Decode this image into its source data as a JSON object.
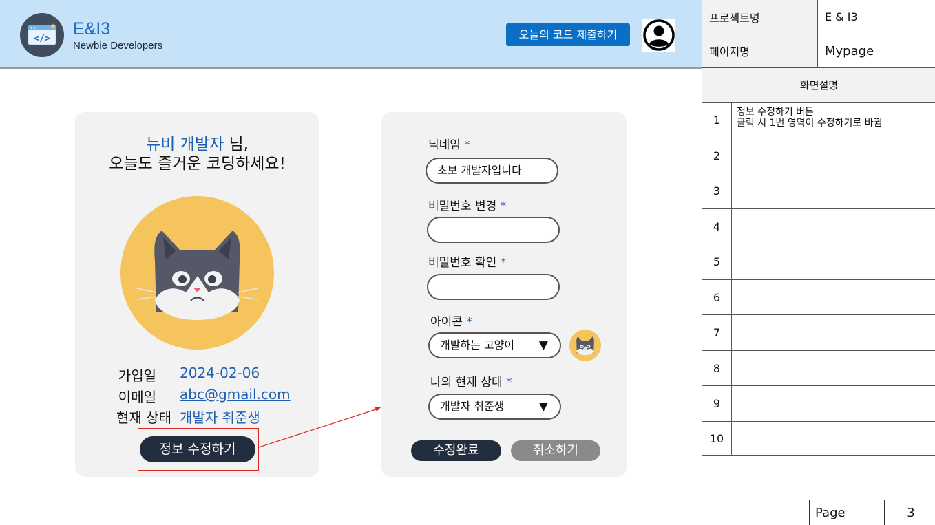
{
  "header": {
    "app_name": "E&I3",
    "app_subtitle": "Newbie Developers",
    "submit_code_label": "오늘의 코드 제출하기",
    "logo_icon": "code-window-icon",
    "avatar_icon": "user-avatar-icon",
    "colors": {
      "background": "#c5e2f8",
      "accent": "#0b6fc7"
    }
  },
  "profile_card": {
    "nickname": "뉴비 개발자",
    "greeting_suffix": " 님,",
    "greeting_line2": "오늘도 즐거운 코딩하세요!",
    "avatar_icon": "cat-icon",
    "info": [
      {
        "label": "가입일",
        "value": "2024-02-06"
      },
      {
        "label": "이메일",
        "value": "abc@gmail.com"
      },
      {
        "label": "현재 상태",
        "value": "개발자 취준생"
      }
    ],
    "edit_button_label": "정보 수정하기"
  },
  "edit_form": {
    "nickname_label": "닉네임",
    "nickname_value": "초보 개발자입니다",
    "password_change_label": "비밀번호 변경",
    "password_change_value": "",
    "password_confirm_label": "비밀번호 확인",
    "password_confirm_value": "",
    "icon_label": "아이콘",
    "icon_value": "개발하는 고양이",
    "status_label": "나의 현재 상태",
    "status_value": "개발자 취준생",
    "required_mark": "*",
    "dropdown_arrow": "▼",
    "save_label": "수정완료",
    "cancel_label": "취소하기"
  },
  "spec": {
    "project_label": "프로젝트명",
    "project_value": "E & I3",
    "page_label": "페이지명",
    "page_value": "Mypage",
    "description_header": "화면설명",
    "rows": [
      {
        "num": "1",
        "line1": "정보 수정하기 버튼",
        "line2": "클릭 시 1번 영역이 수정하기로 바뀜"
      },
      {
        "num": "2",
        "line1": "",
        "line2": ""
      },
      {
        "num": "3",
        "line1": "",
        "line2": ""
      },
      {
        "num": "4",
        "line1": "",
        "line2": ""
      },
      {
        "num": "5",
        "line1": "",
        "line2": ""
      },
      {
        "num": "6",
        "line1": "",
        "line2": ""
      },
      {
        "num": "7",
        "line1": "",
        "line2": ""
      },
      {
        "num": "8",
        "line1": "",
        "line2": ""
      },
      {
        "num": "9",
        "line1": "",
        "line2": ""
      },
      {
        "num": "10",
        "line1": "",
        "line2": ""
      }
    ],
    "page_footer_label": "Page",
    "page_footer_value": "3"
  }
}
